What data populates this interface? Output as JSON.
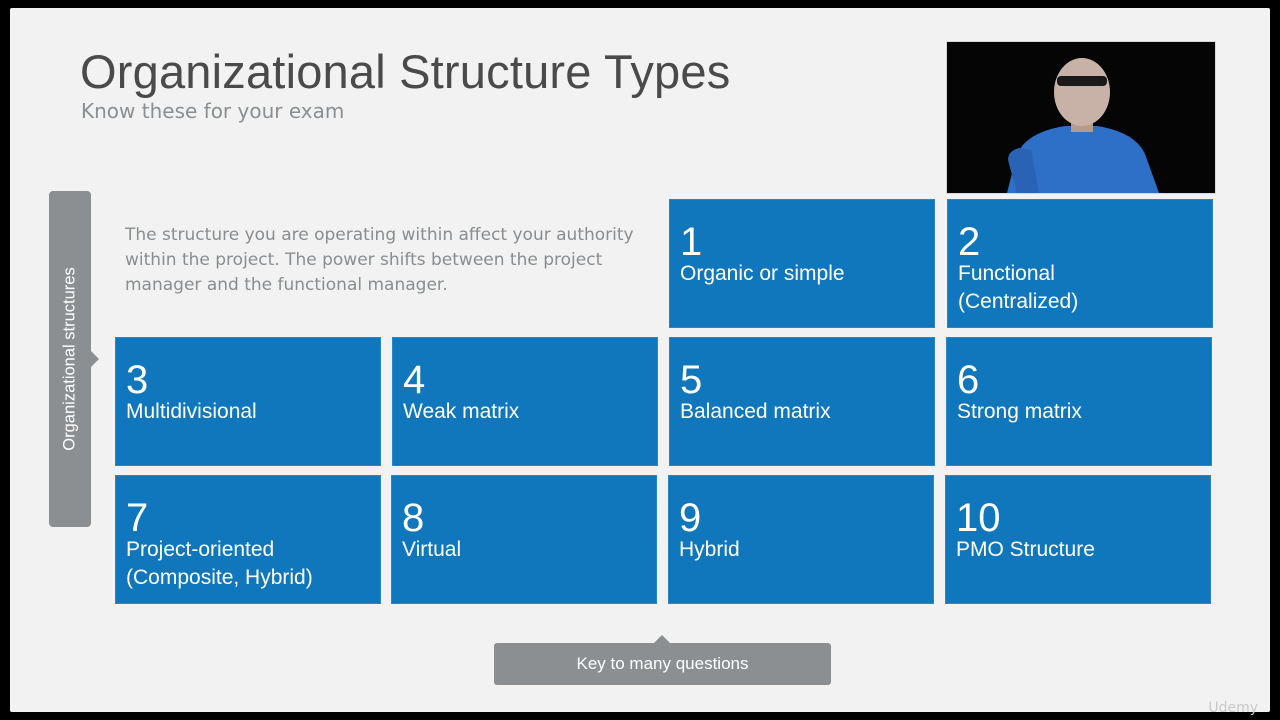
{
  "slide": {
    "title": "Organizational Structure Types",
    "subtitle": "Know these for your exam",
    "side_label": "Organizational structures",
    "intro": "The structure you are operating within affect your authority within the project. The power shifts between the project manager and the functional manager.",
    "callout": "Key to many questions",
    "watermark": "Udemy"
  },
  "tiles": [
    {
      "number": "1",
      "label": "Organic or simple"
    },
    {
      "number": "2",
      "label": "Functional\n(Centralized)"
    },
    {
      "number": "3",
      "label": "Multidivisional"
    },
    {
      "number": "4",
      "label": "Weak matrix"
    },
    {
      "number": "5",
      "label": "Balanced matrix"
    },
    {
      "number": "6",
      "label": "Strong matrix"
    },
    {
      "number": "7",
      "label": "Project-oriented\n(Composite, Hybrid)"
    },
    {
      "number": "8",
      "label": "Virtual"
    },
    {
      "number": "9",
      "label": "Hybrid"
    },
    {
      "number": "10",
      "label": "PMO Structure"
    }
  ],
  "colors": {
    "tile_blue": "#1177bd",
    "label_gray": "#8c8f91",
    "background": "#f1f2f1"
  }
}
